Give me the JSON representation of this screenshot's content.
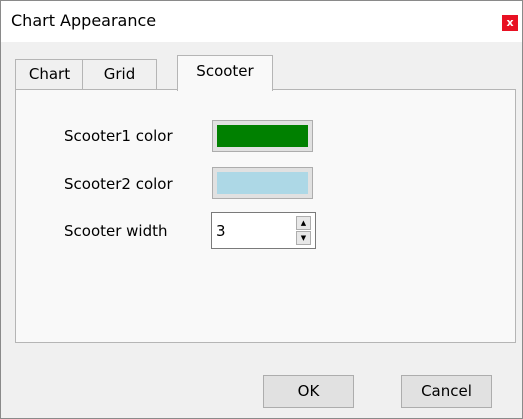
{
  "window": {
    "title": "Chart Appearance",
    "close_glyph": "x"
  },
  "tabs": [
    {
      "label": "Chart",
      "active": false
    },
    {
      "label": "Grid",
      "active": false
    },
    {
      "label": "Scooter",
      "active": true
    }
  ],
  "scooter": {
    "color1_label": "Scooter1 color",
    "color1": "#008000",
    "color2_label": "Scooter2 color",
    "color2": "#add8e6",
    "width_label": "Scooter width",
    "width_value": "3"
  },
  "buttons": {
    "ok": "OK",
    "cancel": "Cancel"
  }
}
